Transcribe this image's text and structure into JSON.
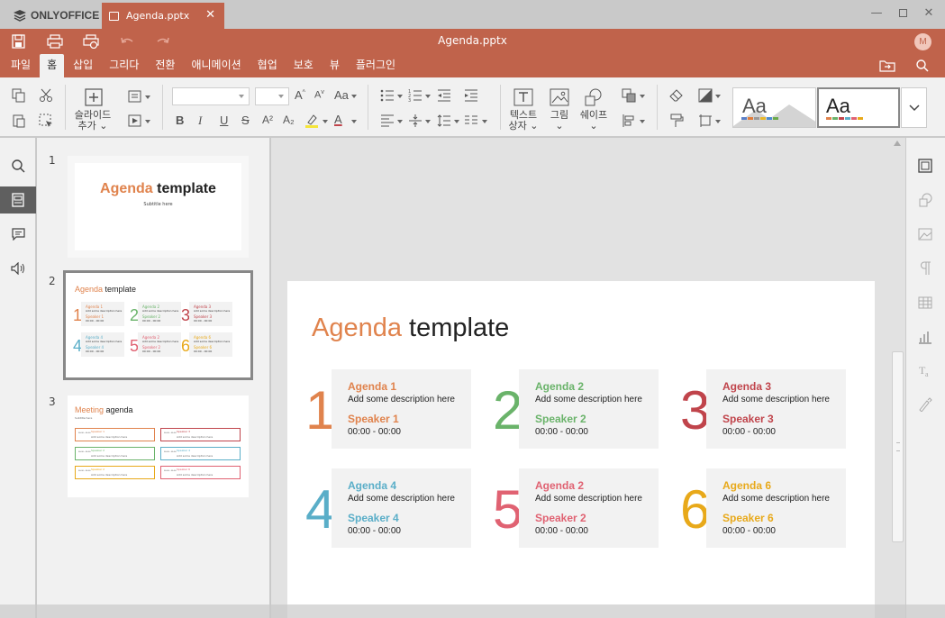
{
  "app": {
    "brand": "ONLYOFFICE",
    "tab_title": "Agenda.pptx",
    "doc_title": "Agenda.pptx",
    "avatar_initial": "M"
  },
  "tabs": [
    "파일",
    "홈",
    "삽입",
    "그리다",
    "전환",
    "애니메이션",
    "협업",
    "보호",
    "뷰",
    "플러그인"
  ],
  "toolbar": {
    "add_slide_line1": "슬라이드",
    "add_slide_line2": "추가",
    "textbox_line1": "텍스트",
    "textbox_line2": "상자",
    "image_label": "그림",
    "shape_label": "쉐이프",
    "theme1": "Aa",
    "theme2": "Aa",
    "font_letters": {
      "bold": "B",
      "italic": "I",
      "underline": "U",
      "strike": "S",
      "sup": "A²",
      "sub": "A₂"
    }
  },
  "slides_panel": [
    {
      "num": "1",
      "title_hl": "Agenda",
      "title_rest": " template",
      "subtitle": "Subtitle here"
    },
    {
      "num": "2",
      "title_hl": "Agenda",
      "title_rest": " template"
    },
    {
      "num": "3",
      "title_hl": "Meeting",
      "title_rest": " agenda",
      "subtitle": "Subtitle here"
    }
  ],
  "slide": {
    "title_hl": "Agenda",
    "title_rest": " template",
    "items": [
      {
        "num": "1",
        "agenda": "Agenda 1",
        "desc": "Add some description here",
        "speaker": "Speaker 1",
        "time": "00:00 - 00:00",
        "color": "#e0834d"
      },
      {
        "num": "2",
        "agenda": "Agenda 2",
        "desc": "Add some description here",
        "speaker": "Speaker 2",
        "time": "00:00 - 00:00",
        "color": "#6ab36a"
      },
      {
        "num": "3",
        "agenda": "Agenda 3",
        "desc": "Add some description here",
        "speaker": "Speaker 3",
        "time": "00:00 - 00:00",
        "color": "#c0444b"
      },
      {
        "num": "4",
        "agenda": "Agenda 4",
        "desc": "Add some description here",
        "speaker": "Speaker 4",
        "time": "00:00 - 00:00",
        "color": "#5aaec8"
      },
      {
        "num": "5",
        "agenda": "Agenda 2",
        "desc": "Add some description here",
        "speaker": "Speaker 2",
        "time": "00:00 - 00:00",
        "color": "#e06272"
      },
      {
        "num": "6",
        "agenda": "Agenda 6",
        "desc": "Add some description here",
        "speaker": "Speaker 6",
        "time": "00:00 - 00:00",
        "color": "#e8a91a"
      }
    ]
  },
  "colors": {
    "header": "#c0634b",
    "accent_orange": "#e0834d"
  }
}
